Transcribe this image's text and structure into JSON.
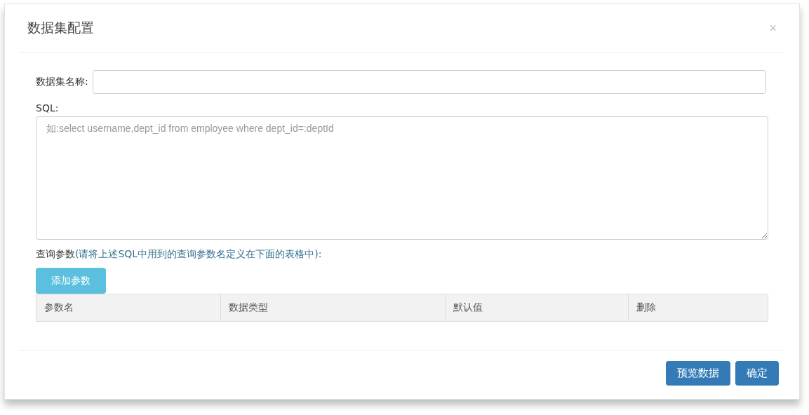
{
  "dialog": {
    "title": "数据集配置",
    "close": "×"
  },
  "name_field": {
    "label": "数据集名称:"
  },
  "sql_field": {
    "label": "SQL:",
    "placeholder": "如:select username,dept_id from employee where dept_id=:deptId"
  },
  "params": {
    "label": "查询参数",
    "hint": "(请将上述SQL中用到的查询参数名定义在下面的表格中):",
    "add_button": "添加参数"
  },
  "table": {
    "columns": [
      "参数名",
      "数据类型",
      "默认值",
      "删除"
    ]
  },
  "buttons": [
    "预览数据",
    "确定"
  ]
}
